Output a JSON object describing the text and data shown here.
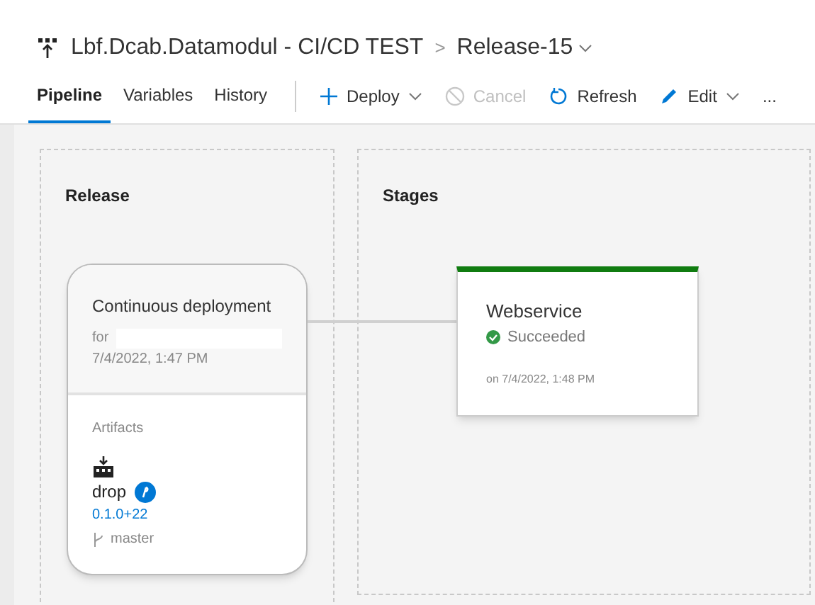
{
  "breadcrumb": {
    "pipeline": "Lbf.Dcab.Datamodul - CI/CD TEST",
    "separator": ">",
    "release": "Release-15"
  },
  "tabs": [
    {
      "label": "Pipeline",
      "selected": true
    },
    {
      "label": "Variables",
      "selected": false
    },
    {
      "label": "History",
      "selected": false
    }
  ],
  "toolbar": [
    {
      "kind": "deploy",
      "label": "Deploy",
      "disabled": false,
      "dropdown": true
    },
    {
      "kind": "cancel",
      "label": "Cancel",
      "disabled": true,
      "dropdown": false
    },
    {
      "kind": "refresh",
      "label": "Refresh",
      "disabled": false,
      "dropdown": false
    },
    {
      "kind": "edit",
      "label": "Edit",
      "disabled": false,
      "dropdown": true
    },
    {
      "kind": "more",
      "label": "...",
      "disabled": false,
      "dropdown": false
    }
  ],
  "release_panel": {
    "title": "Release",
    "trigger": {
      "title": "Continuous deployment",
      "for_label": "for",
      "time": "7/4/2022, 1:47 PM"
    },
    "artifacts": {
      "title": "Artifacts",
      "items": [
        {
          "name": "drop",
          "version": "0.1.0+22",
          "branch": "master"
        }
      ]
    }
  },
  "stages_panel": {
    "title": "Stages",
    "stages": [
      {
        "name": "Webservice",
        "status": "Succeeded",
        "time": "on 7/4/2022, 1:48 PM"
      }
    ]
  }
}
